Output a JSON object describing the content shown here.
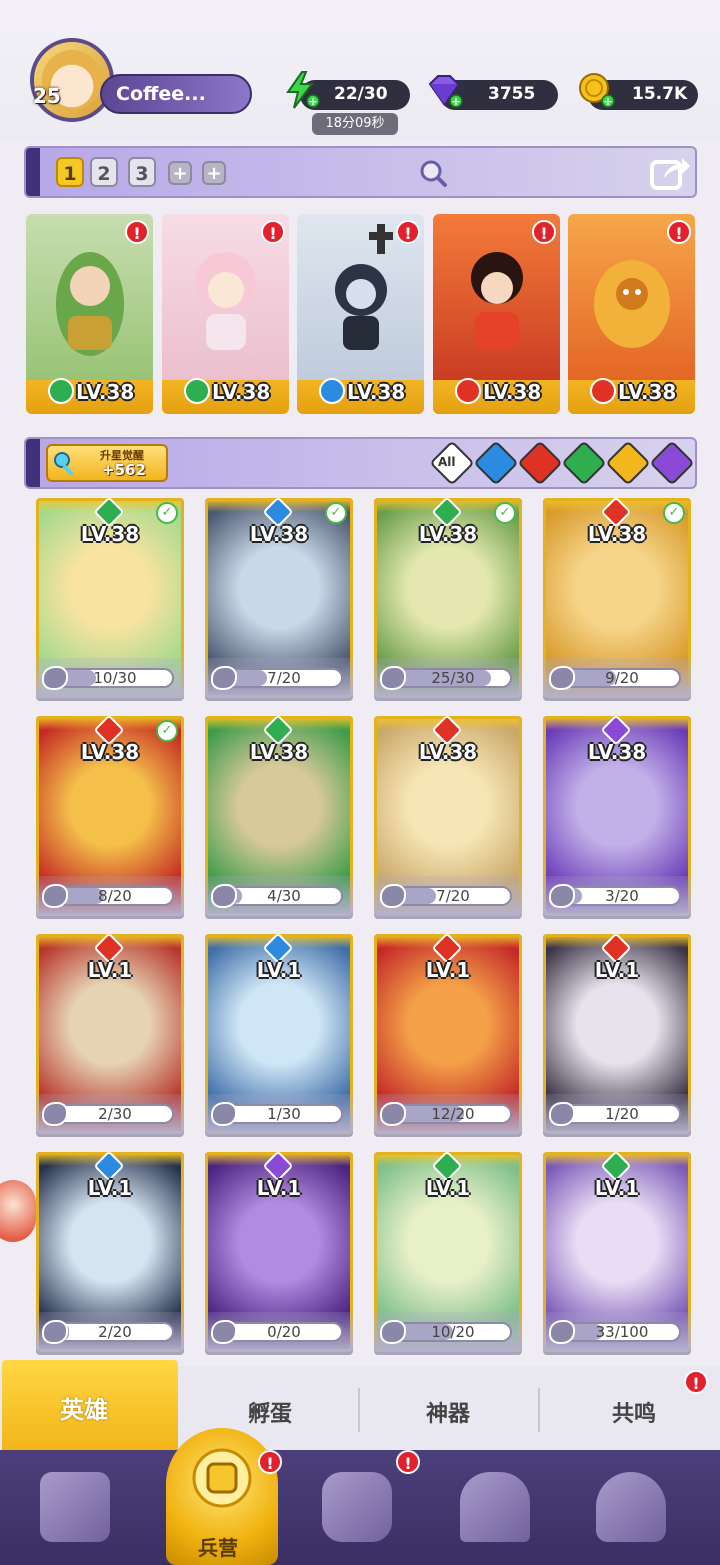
{
  "player": {
    "level": "25",
    "name": "Coffee..."
  },
  "resources": {
    "energy": "22/30",
    "energy_timer": "18分09秒",
    "gems": "3755",
    "gold": "15.7K"
  },
  "teams": {
    "tabs": [
      "1",
      "2",
      "3"
    ],
    "add": [
      "+",
      "+"
    ]
  },
  "deployed": [
    {
      "level": "LV.38",
      "element": "wind",
      "color": "#2eae4e"
    },
    {
      "level": "LV.38",
      "element": "wind",
      "color": "#2eae4e"
    },
    {
      "level": "LV.38",
      "element": "water",
      "color": "#2a8be0"
    },
    {
      "level": "LV.38",
      "element": "fire",
      "color": "#e03224"
    },
    {
      "level": "LV.38",
      "element": "fire",
      "color": "#e03224"
    }
  ],
  "roster_header": {
    "star_label": "升星觉醒",
    "star_value": "+562",
    "filter_all": "All",
    "filters": [
      {
        "element": "water",
        "color": "#2a8be0"
      },
      {
        "element": "fire",
        "color": "#e03224"
      },
      {
        "element": "wind",
        "color": "#2eae4e"
      },
      {
        "element": "light",
        "color": "#f2b71c"
      },
      {
        "element": "dark",
        "color": "#8a4ad6"
      }
    ]
  },
  "heroes": [
    {
      "level": "LV.38",
      "shards": "10/30",
      "progress": 0.33,
      "element": "wind",
      "color": "#2eae4e",
      "check": true,
      "art": [
        "#f8e3a1",
        "#a4d98b"
      ]
    },
    {
      "level": "LV.38",
      "shards": "7/20",
      "progress": 0.35,
      "element": "water",
      "color": "#2a8be0",
      "check": true,
      "art": [
        "#c8d8e8",
        "#4c5870"
      ]
    },
    {
      "level": "LV.38",
      "shards": "25/30",
      "progress": 0.83,
      "element": "wind",
      "color": "#2eae4e",
      "check": true,
      "art": [
        "#e4e8b0",
        "#6a9e4a"
      ]
    },
    {
      "level": "LV.38",
      "shards": "9/20",
      "progress": 0.45,
      "element": "fire",
      "color": "#e03224",
      "check": true,
      "art": [
        "#f6d58a",
        "#d89a2c"
      ]
    },
    {
      "level": "LV.38",
      "shards": "8/20",
      "progress": 0.4,
      "element": "fire",
      "color": "#e03224",
      "check": true,
      "art": [
        "#f4c04a",
        "#c42a24"
      ]
    },
    {
      "level": "LV.38",
      "shards": "4/30",
      "progress": 0.13,
      "element": "wind",
      "color": "#2eae4e",
      "check": false,
      "art": [
        "#d8c99a",
        "#3d9c4a"
      ]
    },
    {
      "level": "LV.38",
      "shards": "7/20",
      "progress": 0.35,
      "element": "fire",
      "color": "#e03224",
      "check": false,
      "art": [
        "#f6e5b5",
        "#c9a86a"
      ]
    },
    {
      "level": "LV.38",
      "shards": "3/20",
      "progress": 0.15,
      "element": "dark",
      "color": "#8a4ad6",
      "check": false,
      "art": [
        "#c2b0e8",
        "#6a3cb8"
      ]
    },
    {
      "level": "LV.1",
      "shards": "2/30",
      "progress": 0.07,
      "element": "fire",
      "color": "#e03224",
      "check": false,
      "art": [
        "#e6d3b4",
        "#b7372c"
      ]
    },
    {
      "level": "LV.1",
      "shards": "1/30",
      "progress": 0.03,
      "element": "water",
      "color": "#2a8be0",
      "check": false,
      "art": [
        "#cfe6f6",
        "#3f6ea8"
      ]
    },
    {
      "level": "LV.1",
      "shards": "12/20",
      "progress": 0.6,
      "element": "fire",
      "color": "#e03224",
      "check": false,
      "art": [
        "#f3a048",
        "#c42828"
      ]
    },
    {
      "level": "LV.1",
      "shards": "1/20",
      "progress": 0.05,
      "element": "fire",
      "color": "#e03224",
      "check": false,
      "art": [
        "#e8e2ec",
        "#3a3446"
      ]
    },
    {
      "level": "LV.1",
      "shards": "2/20",
      "progress": 0.1,
      "element": "water",
      "color": "#2a8be0",
      "check": false,
      "art": [
        "#d6e4f2",
        "#27324e"
      ]
    },
    {
      "level": "LV.1",
      "shards": "0/20",
      "progress": 0.0,
      "element": "dark",
      "color": "#8a4ad6",
      "check": false,
      "art": [
        "#b28ae0",
        "#4b2380"
      ]
    },
    {
      "level": "LV.1",
      "shards": "10/20",
      "progress": 0.5,
      "element": "wind",
      "color": "#2eae4e",
      "check": false,
      "art": [
        "#e8f0c8",
        "#7fbf8a"
      ]
    },
    {
      "level": "LV.1",
      "shards": "33/100",
      "progress": 0.33,
      "element": "wind",
      "color": "#2eae4e",
      "check": false,
      "art": [
        "#eadcf4",
        "#7a5ab8"
      ]
    }
  ],
  "subtabs": [
    "英雄",
    "孵蛋",
    "神器",
    "共鸣"
  ],
  "bottom_nav": {
    "active_label": "兵营",
    "icons": [
      "cards-icon",
      "barracks-icon",
      "codex-icon",
      "castle-icon",
      "mushroom-icon"
    ]
  }
}
